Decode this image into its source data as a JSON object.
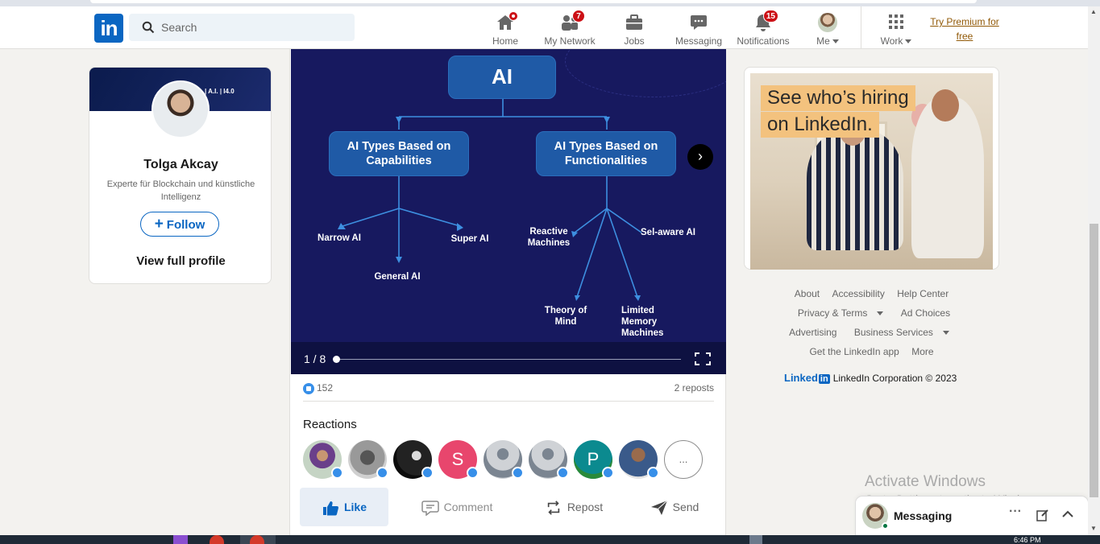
{
  "header": {
    "search_placeholder": "Search",
    "nav": [
      {
        "label": "Home",
        "icon": "home-icon",
        "badge": "dot"
      },
      {
        "label": "My Network",
        "icon": "network-icon",
        "badge": "7"
      },
      {
        "label": "Jobs",
        "icon": "briefcase-icon",
        "badge": ""
      },
      {
        "label": "Messaging",
        "icon": "chat-icon",
        "badge": ""
      },
      {
        "label": "Notifications",
        "icon": "bell-icon",
        "badge": "15"
      },
      {
        "label": "Me",
        "icon": "avatar",
        "badge": ""
      },
      {
        "label": "Work",
        "icon": "grid-icon",
        "badge": ""
      }
    ],
    "premium_line1": "Try Premium for",
    "premium_line2": "free"
  },
  "profile": {
    "banner_text": "| A.I. | I4.0",
    "name": "Tolga Akcay",
    "headline": "Experte für Blockchain und künstliche Intelligenz",
    "follow_label": "Follow",
    "view_profile_label": "View full profile"
  },
  "post": {
    "slide": {
      "root": "AI",
      "left_branch": "AI Types Based on Capabilities",
      "right_branch": "AI Types Based on Functionalities",
      "left_children": [
        "Narrow AI",
        "General AI",
        "Super AI"
      ],
      "right_children": [
        "Reactive Machines",
        "Theory of Mind",
        "Limited Memory Machines",
        "Sel-aware AI"
      ],
      "counter": "1 / 8"
    },
    "likes_count": "152",
    "reposts": "2 reposts",
    "reactions_title": "Reactions",
    "reactors": [
      {
        "type": "photo"
      },
      {
        "type": "photo"
      },
      {
        "type": "photo"
      },
      {
        "type": "letter",
        "letter": "S"
      },
      {
        "type": "placeholder"
      },
      {
        "type": "placeholder"
      },
      {
        "type": "letter",
        "letter": "P"
      },
      {
        "type": "photo"
      },
      {
        "type": "more",
        "letter": "..."
      }
    ],
    "actions": {
      "like": "Like",
      "comment": "Comment",
      "repost": "Repost",
      "send": "Send"
    }
  },
  "ad": {
    "headline_line1": "See who’s hiring",
    "headline_line2": "on LinkedIn."
  },
  "footer": {
    "row1": [
      "About",
      "Accessibility",
      "Help Center"
    ],
    "row2": [
      "Privacy & Terms",
      "Ad Choices"
    ],
    "row3": [
      "Advertising",
      "Business Services"
    ],
    "row4": [
      "Get the LinkedIn app",
      "More"
    ],
    "brand": "Linked",
    "brand_in": "in",
    "copyright": "LinkedIn Corporation © 2023"
  },
  "watermark": {
    "line1": "Activate Windows",
    "line2": "Go to Settings to activate Windows."
  },
  "messaging": {
    "title": "Messaging"
  },
  "taskbar": {
    "time": "6:46 PM"
  },
  "colors": {
    "brand": "#0a66c2",
    "badge": "#cc1016",
    "premium": "#915907",
    "slide_bg": "#17195f",
    "node_bg": "#1f5aa6"
  }
}
